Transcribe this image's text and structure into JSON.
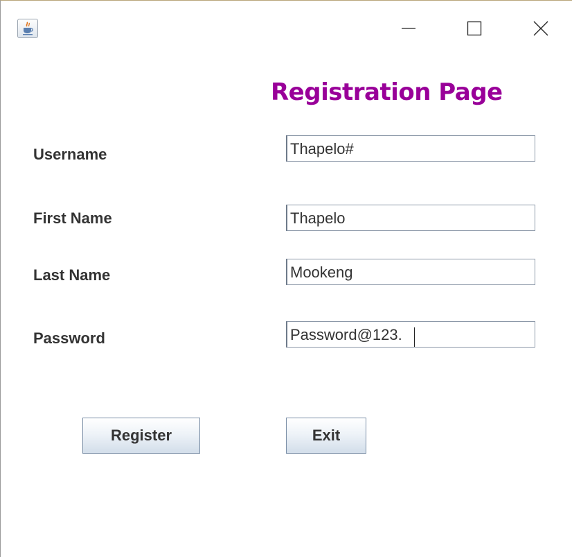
{
  "window": {
    "title_icon": "java-cup-icon",
    "controls": {
      "minimize": "minimize-icon",
      "maximize": "maximize-icon",
      "close": "close-icon"
    }
  },
  "page": {
    "title": "Registration Page",
    "title_color": "#990099"
  },
  "form": {
    "username": {
      "label": "Username",
      "value": "Thapelo#"
    },
    "first_name": {
      "label": "First Name",
      "value": "Thapelo"
    },
    "last_name": {
      "label": "Last Name",
      "value": "Mookeng"
    },
    "password": {
      "label": "Password",
      "value": "Password@123."
    }
  },
  "buttons": {
    "register": "Register",
    "exit": "Exit"
  }
}
